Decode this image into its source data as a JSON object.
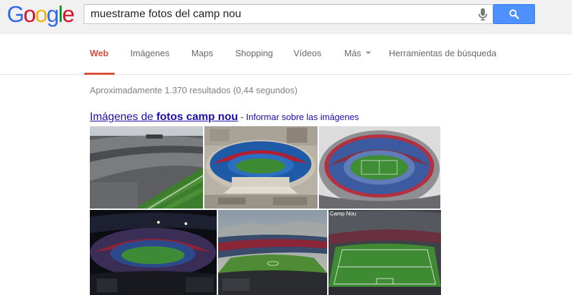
{
  "logo": {
    "letters": [
      "G",
      "o",
      "o",
      "g",
      "l",
      "e"
    ],
    "colors": [
      "#3369e8",
      "#d50f25",
      "#eeb211",
      "#3369e8",
      "#009925",
      "#d50f25"
    ]
  },
  "search": {
    "query": "muestrame fotos del camp nou"
  },
  "tabs": [
    {
      "label": "Web",
      "active": true
    },
    {
      "label": "Imágenes"
    },
    {
      "label": "Maps"
    },
    {
      "label": "Shopping"
    },
    {
      "label": "Vídeos"
    },
    {
      "label": "Más"
    },
    {
      "label": "Herramientas de búsqueda"
    }
  ],
  "results": {
    "stats": "Aproximadamente 1.370 resultados (0,44 segundos)",
    "images_prefix": "Imágenes de ",
    "images_query": "fotos camp nou",
    "report_sep": " - ",
    "report_link": "Informar sobre las imágenes",
    "thumbnails": [
      {
        "icon": "stadium-photo"
      },
      {
        "icon": "stadium-aerial-photo"
      },
      {
        "icon": "stadium-overview-photo"
      },
      {
        "icon": "stadium-night-photo"
      },
      {
        "icon": "stadium-sunset-photo"
      },
      {
        "icon": "stadium-wide-photo",
        "caption": "Camp Nou"
      }
    ]
  },
  "colors": {
    "accent": "#dd4b39",
    "search_button": "#4d90fe",
    "link": "#1a0dab"
  }
}
